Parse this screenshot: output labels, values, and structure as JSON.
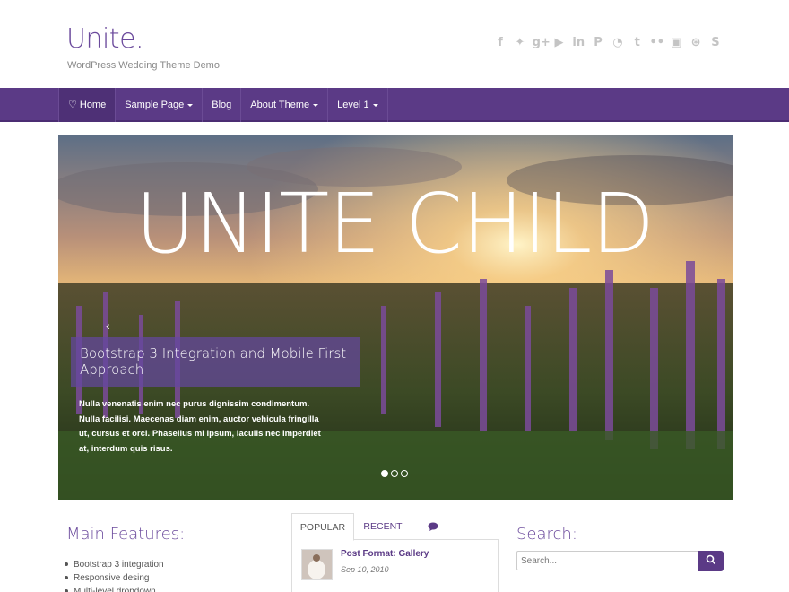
{
  "header": {
    "title": "Unite.",
    "description": "WordPress Wedding Theme Demo"
  },
  "social_icons": [
    "facebook-icon",
    "twitter-icon",
    "google-plus-icon",
    "youtube-icon",
    "linkedin-icon",
    "pinterest-icon",
    "rss-icon",
    "tumblr-icon",
    "flickr-icon",
    "instagram-icon",
    "dribbble-icon",
    "skype-icon"
  ],
  "nav": {
    "items": [
      {
        "label": "Home",
        "active": true
      },
      {
        "label": "Sample Page",
        "dropdown": true
      },
      {
        "label": "Blog"
      },
      {
        "label": "About Theme",
        "dropdown": true
      },
      {
        "label": "Level 1",
        "dropdown": true
      }
    ]
  },
  "slider": {
    "overlay_title": "UNITE CHILD",
    "caption_title": "Bootstrap 3 Integration and Mobile First Approach",
    "caption_text": "Nulla venenatis enim nec purus dignissim condimentum. Nulla facilisi. Maecenas diam enim, auctor vehicula fringilla ut, cursus et orci. Phasellus mi ipsum, iaculis nec imperdiet at, interdum quis risus.",
    "active_slide": 1,
    "slide_count": 3
  },
  "features": {
    "title": "Main Features:",
    "items": [
      "Bootstrap 3 integration",
      "Responsive desing",
      "Multi-level dropdown..."
    ]
  },
  "tabs": {
    "popular_label": "POPULAR",
    "recent_label": "RECENT",
    "post_title": "Post Format: Gallery",
    "post_date": "Sep 10, 2010"
  },
  "search": {
    "title": "Search:",
    "placeholder": "Search..."
  },
  "colors": {
    "brand": "#5b3a86",
    "title": "#6b4a9c"
  }
}
